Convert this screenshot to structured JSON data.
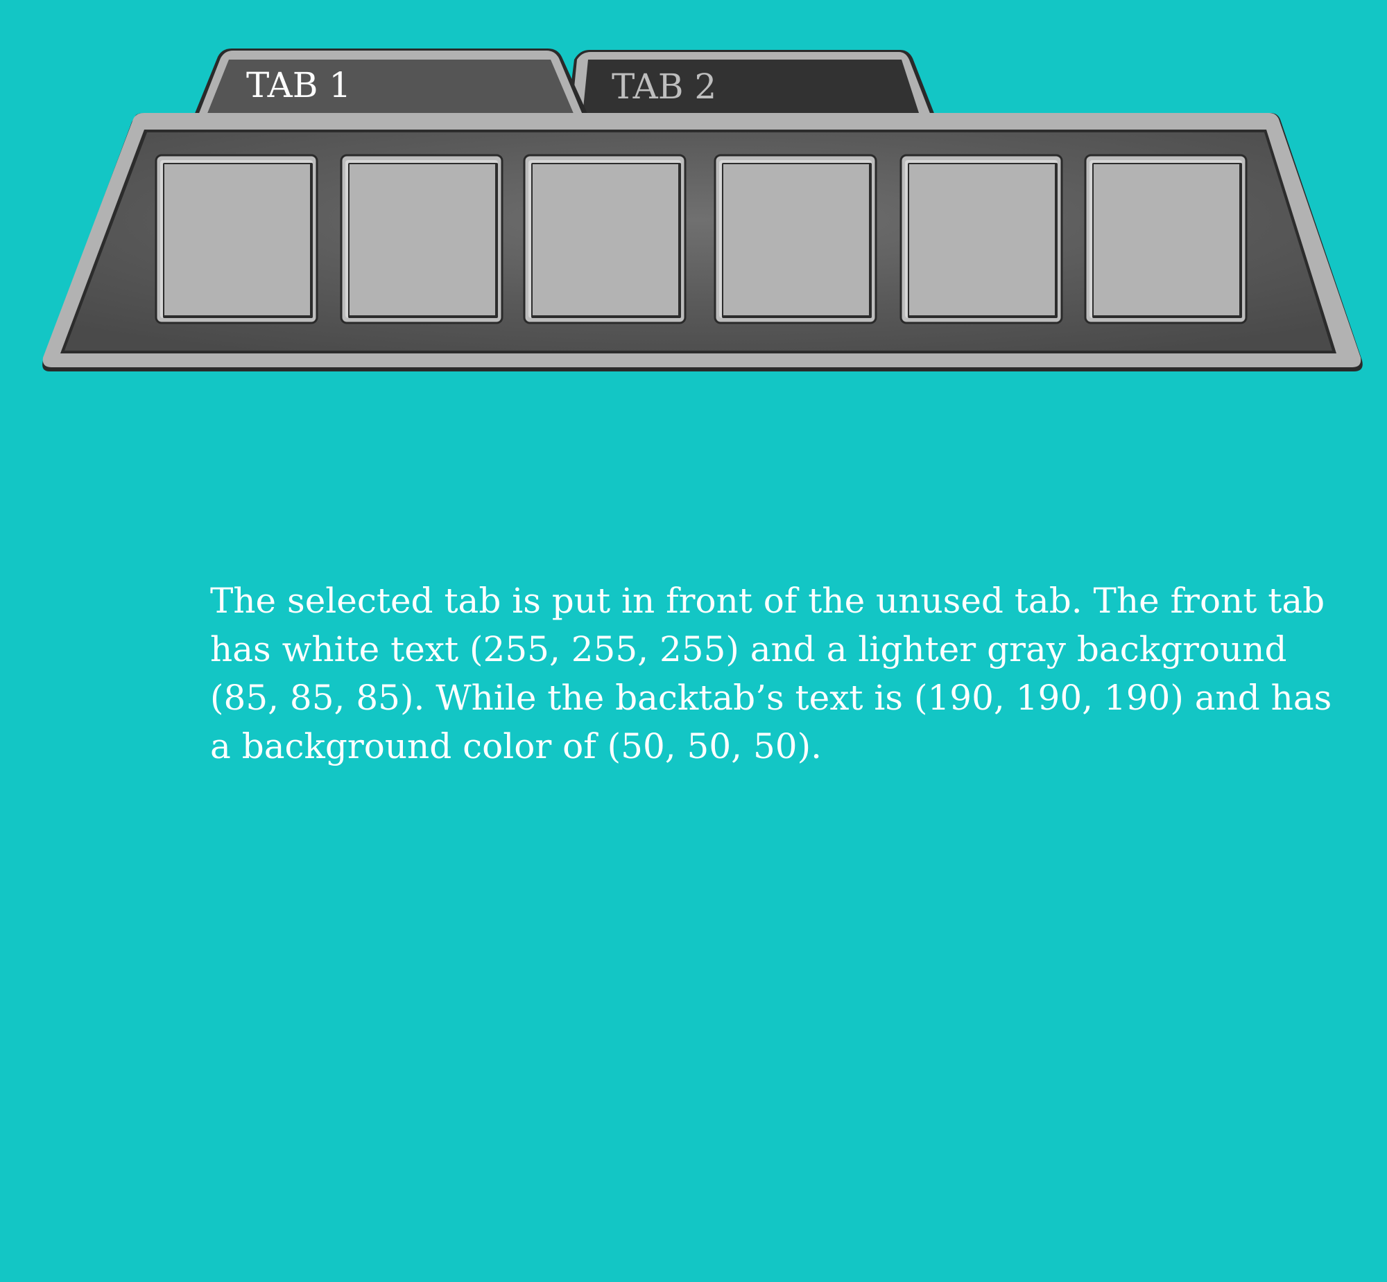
{
  "tabs": [
    {
      "label": "TAB 1",
      "state": "selected",
      "text_color": "#ffffff",
      "background": "#555555"
    },
    {
      "label": "TAB 2",
      "state": "unselected",
      "text_color": "#bebebe",
      "background": "#323232"
    }
  ],
  "panel": {
    "slot_count": 6,
    "frame_color": "#b2b2b2",
    "fill_color": "#5a5a5a",
    "slot_color": "#b3b3b3"
  },
  "description": {
    "lines": [
      "The selected tab is put in front of the unused tab.  The front tab",
      "has white text (255, 255, 255) and a lighter gray background",
      "(85, 85, 85).  While the backtab’s text is (190, 190, 190) and has",
      "a background color of (50, 50, 50)."
    ]
  },
  "background_color": "#13c6c5"
}
